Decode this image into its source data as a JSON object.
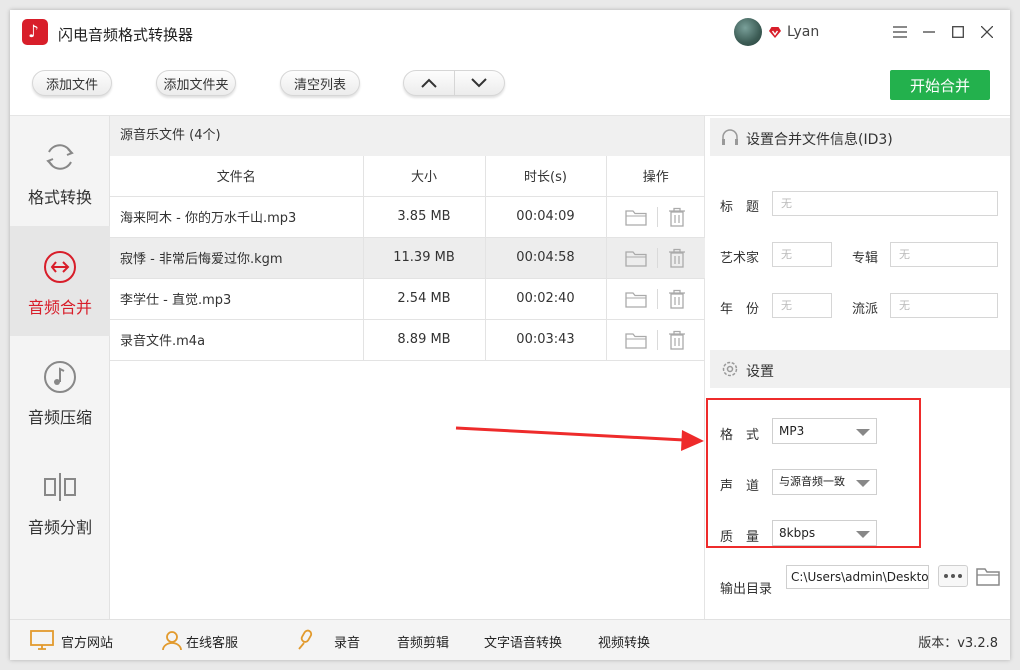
{
  "app": {
    "title": "闪电音频格式转换器",
    "username": "Lyan"
  },
  "toolbar": {
    "add_file": "添加文件",
    "add_folder": "添加文件夹",
    "clear_list": "清空列表",
    "start_merge": "开始合并"
  },
  "sidebar": {
    "items": [
      {
        "label": "格式转换",
        "icon": "refresh-icon"
      },
      {
        "label": "音频合并",
        "icon": "merge-icon",
        "active": true
      },
      {
        "label": "音频压缩",
        "icon": "music-note-icon"
      },
      {
        "label": "音频分割",
        "icon": "split-icon"
      }
    ]
  },
  "file_list": {
    "header": "源音乐文件 (4个)",
    "columns": [
      "文件名",
      "大小",
      "时长(s)",
      "操作"
    ],
    "rows": [
      {
        "name": "海来阿木 - 你的万水千山.mp3",
        "size": "3.85 MB",
        "duration": "00:04:09"
      },
      {
        "name": "寂悸 - 非常后悔爱过你.kgm",
        "size": "11.39 MB",
        "duration": "00:04:58"
      },
      {
        "name": "李学仕 - 直觉.mp3",
        "size": "2.54 MB",
        "duration": "00:02:40"
      },
      {
        "name": "录音文件.m4a",
        "size": "8.89 MB",
        "duration": "00:03:43"
      }
    ]
  },
  "id3": {
    "header": "设置合并文件信息(ID3)",
    "title_label": "标　题",
    "artist_label": "艺术家",
    "album_label": "专辑",
    "year_label": "年　份",
    "genre_label": "流派",
    "placeholder": "无"
  },
  "settings": {
    "header": "设置",
    "format_label": "格　式",
    "format_value": "MP3",
    "channel_label": "声　道",
    "channel_value": "与源音频一致",
    "quality_label": "质　量",
    "quality_value": "8kbps",
    "output_label": "输出目录",
    "output_value": "C:\\Users\\admin\\Desktop"
  },
  "footer": {
    "website": "官方网站",
    "support": "在线客服",
    "record": "录音",
    "audio_cut": "音频剪辑",
    "tts": "文字语音转换",
    "video_convert": "视频转换",
    "version": "版本：v3.2.8"
  },
  "colors": {
    "accent_red": "#d81e2a",
    "start_green": "#23b14d",
    "highlight_red": "#ee2b2b"
  }
}
